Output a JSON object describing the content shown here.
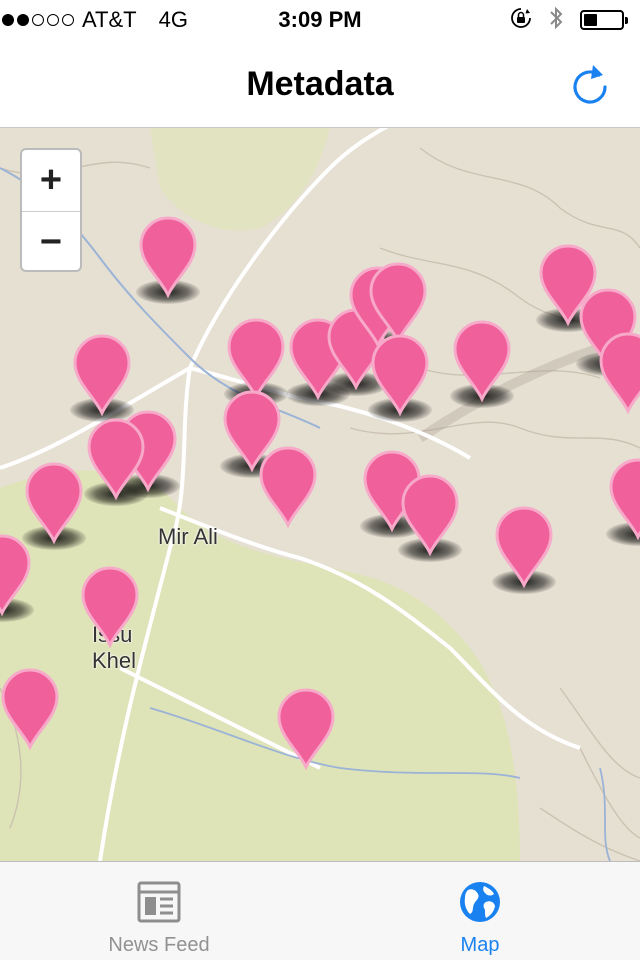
{
  "status_bar": {
    "signal_filled": 2,
    "signal_total": 5,
    "carrier": "AT&T",
    "network": "4G",
    "time": "3:09 PM",
    "icons": [
      "rotation-lock-icon",
      "bluetooth-icon",
      "battery-icon"
    ],
    "battery_level": 0.35
  },
  "nav": {
    "title": "Metadata",
    "right_button_icon": "refresh-icon",
    "accent_color": "#1a82f0"
  },
  "map": {
    "zoom_in_label": "+",
    "zoom_out_label": "−",
    "labels": [
      "Mir Ali",
      "Issu Khel"
    ],
    "pin_color": "#f0609a",
    "pin_count": 25
  },
  "tab_bar": {
    "tabs": [
      {
        "label": "News Feed",
        "icon": "news-feed-icon",
        "selected": false
      },
      {
        "label": "Map",
        "icon": "globe-icon",
        "selected": true
      }
    ]
  }
}
